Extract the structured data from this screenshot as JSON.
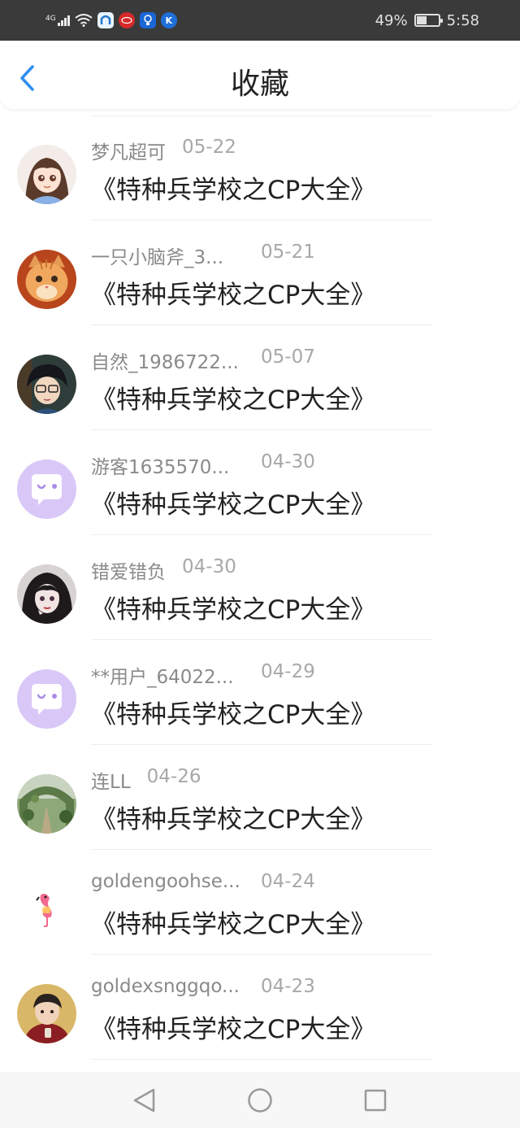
{
  "status_bar": {
    "network": "4G",
    "battery_percent_text": "49%",
    "battery_level": 0.49,
    "time": "5:58",
    "app_icons": [
      "browser-icon",
      "weibo-icon",
      "lightbulb-icon",
      "k-app-icon"
    ]
  },
  "header": {
    "title": "收藏",
    "back_icon": "chevron-left-icon"
  },
  "favorites": [
    {
      "name": "梦凡超可",
      "date": "05-22",
      "book": "《特种兵学校之CP大全》",
      "avatar": "anime-girl-avatar"
    },
    {
      "name": "一只小脑斧_3...",
      "date": "05-21",
      "book": "《特种兵学校之CP大全》",
      "avatar": "cat-avatar"
    },
    {
      "name": "自然_1986722...",
      "date": "05-07",
      "book": "《特种兵学校之CP大全》",
      "avatar": "anime-boy-avatar"
    },
    {
      "name": "游客1635570...",
      "date": "04-30",
      "book": "《特种兵学校之CP大全》",
      "avatar": "default-chat-avatar"
    },
    {
      "name": "错爱错负",
      "date": "04-30",
      "book": "《特种兵学校之CP大全》",
      "avatar": "dark-hair-girl-avatar"
    },
    {
      "name": "**用户_64022...",
      "date": "04-29",
      "book": "《特种兵学校之CP大全》",
      "avatar": "default-chat-avatar"
    },
    {
      "name": "连LL",
      "date": "04-26",
      "book": "《特种兵学校之CP大全》",
      "avatar": "garden-arch-avatar"
    },
    {
      "name": "goldengoohse...",
      "date": "04-24",
      "book": "《特种兵学校之CP大全》",
      "avatar": "flamingo-avatar"
    },
    {
      "name": "goldexsnggqo...",
      "date": "04-23",
      "book": "《特种兵学校之CP大全》",
      "avatar": "boy-red-jacket-avatar"
    }
  ],
  "nav_bar": {
    "back": "triangle-back-icon",
    "home": "circle-home-icon",
    "recents": "square-recents-icon"
  },
  "colors": {
    "accent": "#2e8ff0",
    "status_bar_bg": "#3a3a3a",
    "default_avatar_bg": "#d9c8f7"
  }
}
